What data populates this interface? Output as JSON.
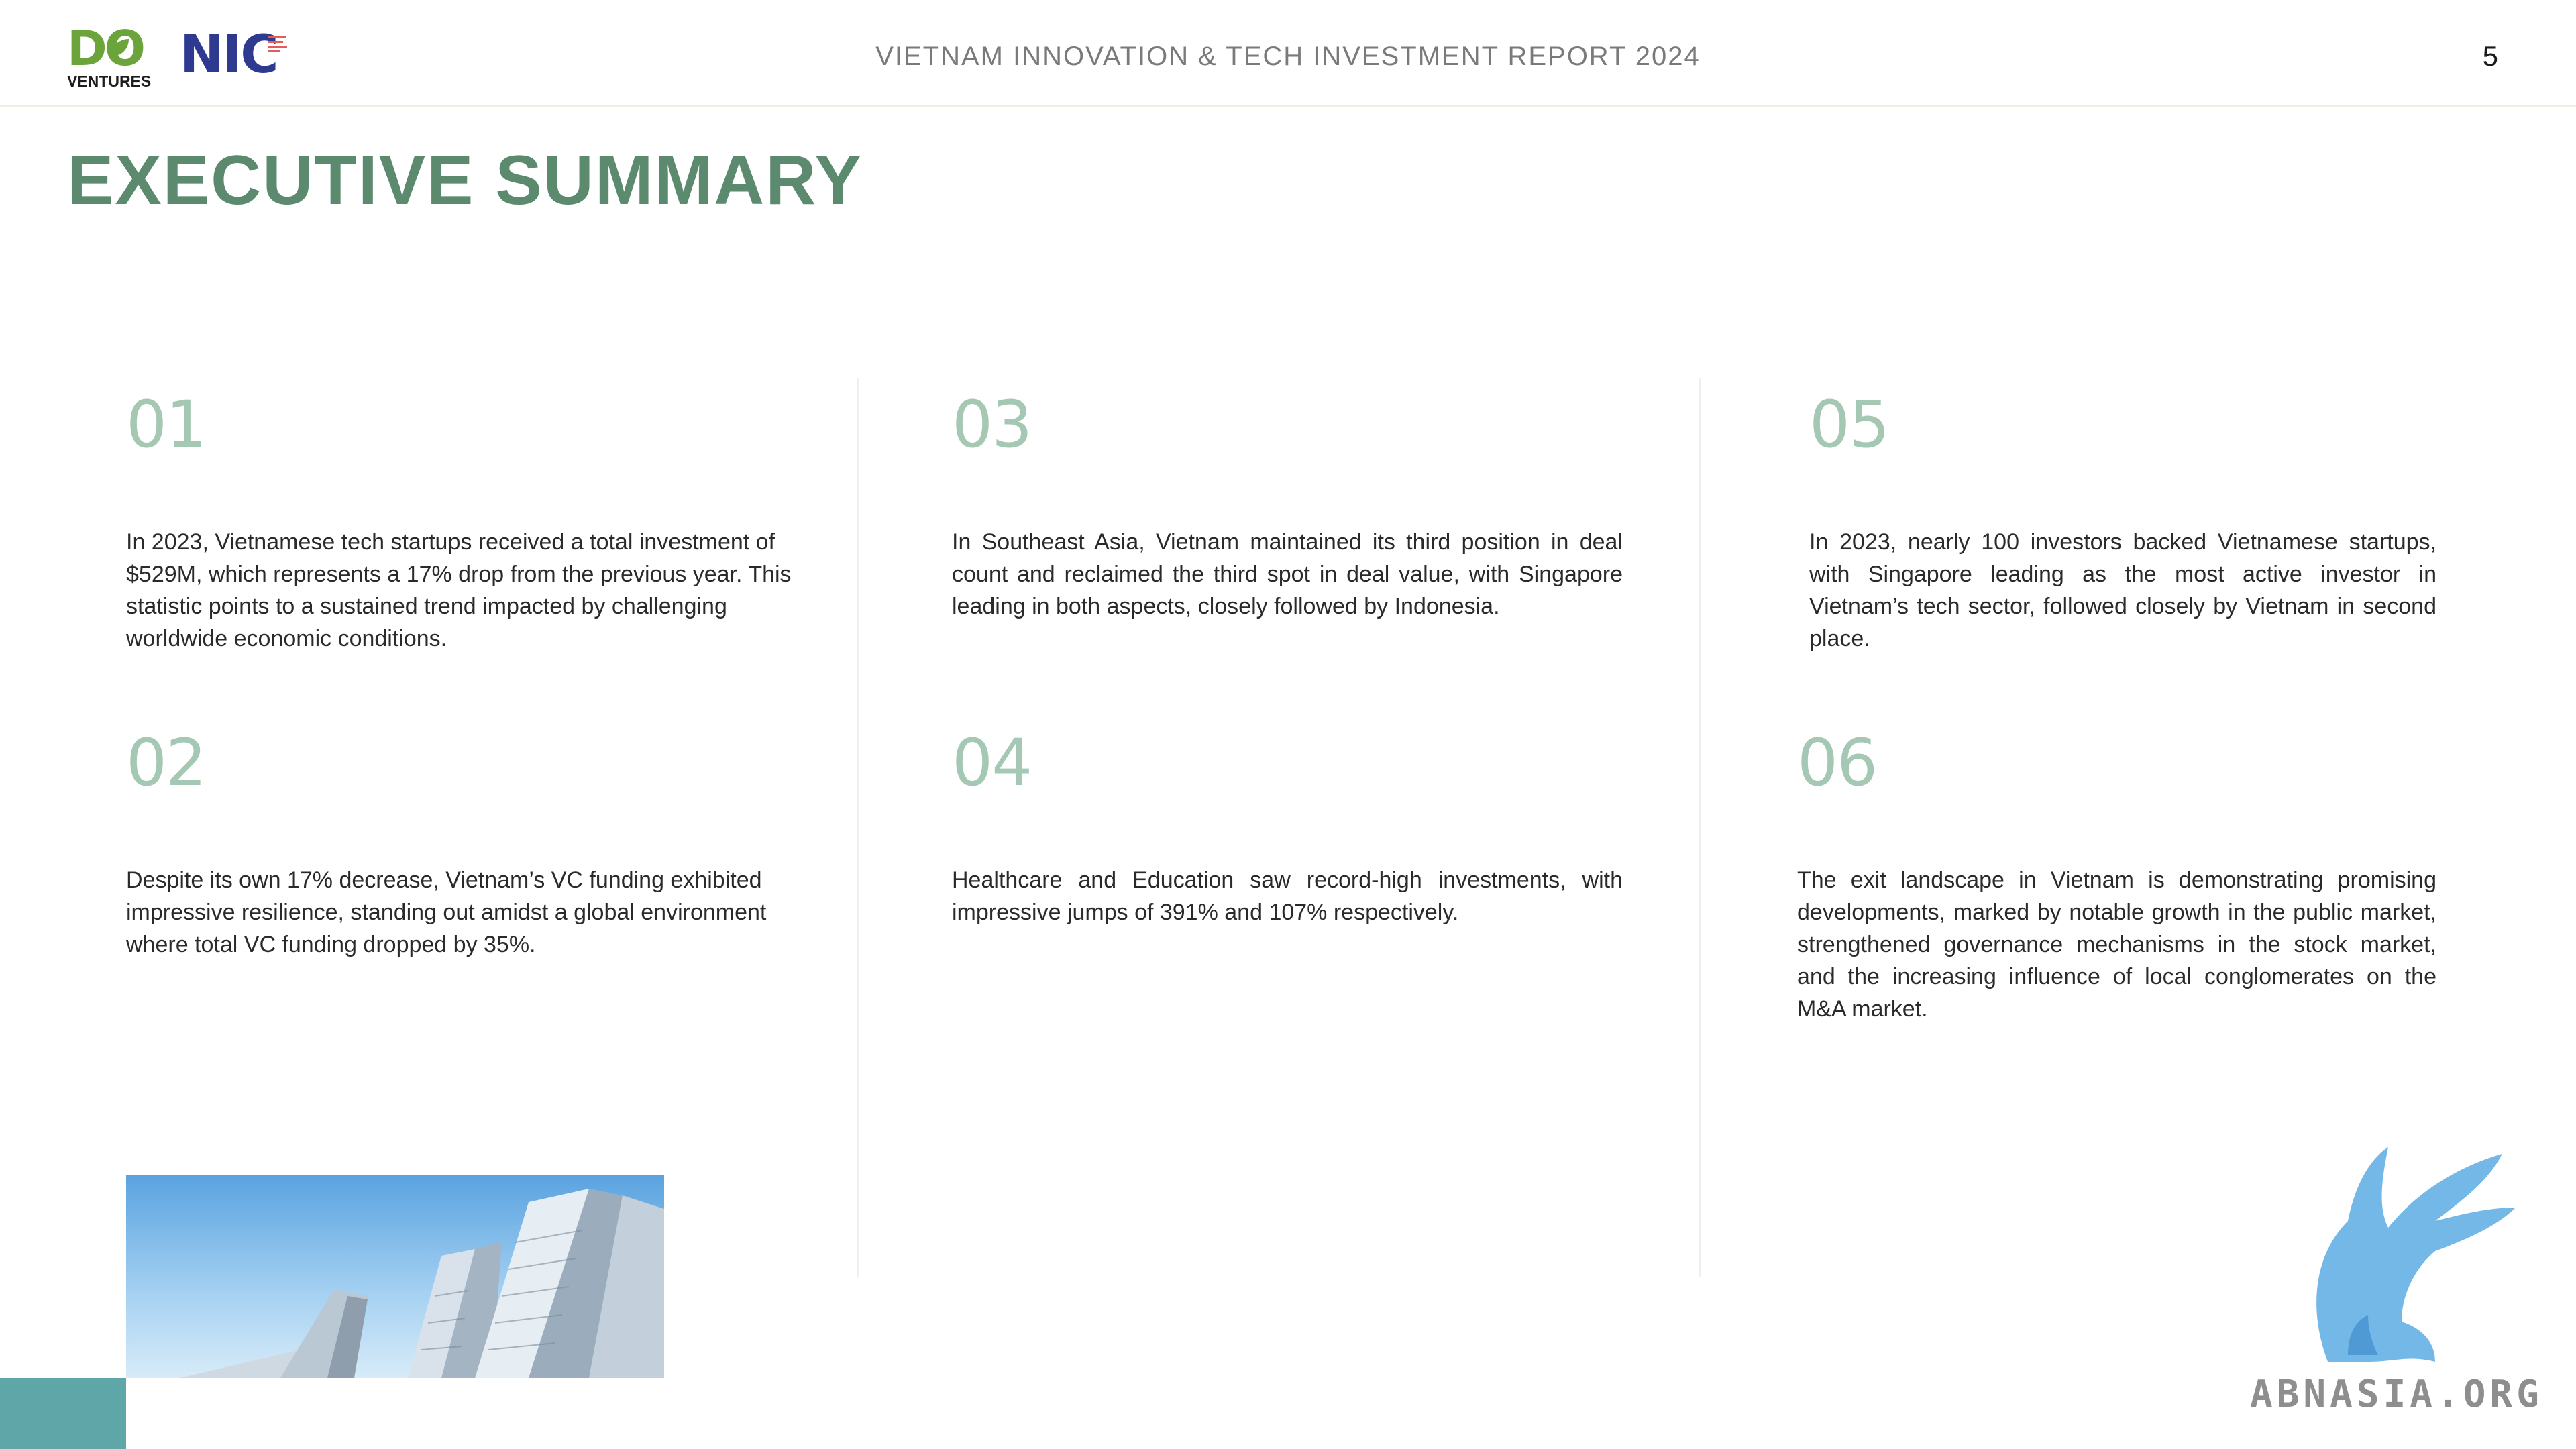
{
  "header": {
    "logo_do_text": "DO",
    "logo_do_sub": "VENTURES",
    "logo_nic_text": "NIC",
    "report_title": "VIETNAM INNOVATION & TECH INVESTMENT REPORT 2024",
    "page_number": "5"
  },
  "title": "EXECUTIVE SUMMARY",
  "items": [
    {
      "num": "01",
      "text": "In 2023, Vietnamese tech startups received a total investment of $529M, which represents a 17% drop from the previous year. This statistic points to a sustained trend impacted by challenging worldwide economic conditions."
    },
    {
      "num": "02",
      "text": "Despite its own 17% decrease, Vietnam’s VC funding exhibited impressive resilience, standing out amidst a global environment where total VC funding dropped by 35%."
    },
    {
      "num": "03",
      "text": "In Southeast Asia, Vietnam maintained its third position in deal count and reclaimed the third spot in deal value, with Singapore leading in both aspects, closely followed by Indonesia."
    },
    {
      "num": "04",
      "text": "Healthcare and Education saw record-high investments, with impressive jumps of 391% and 107% respectively."
    },
    {
      "num": "05",
      "text": "In 2023, nearly 100 investors backed Vietnamese startups, with Singapore leading as the most active investor in Vietnam’s tech sector, followed closely by Vietnam in second place."
    },
    {
      "num": "06",
      "text": "The exit landscape in Vietnam is demonstrating promising developments, marked by notable growth in the public market, strengthened governance mechanisms in the stock market, and the increasing influence of local conglomerates on the M&A market."
    }
  ],
  "watermark": "ABNASIA.ORG",
  "colors": {
    "title": "#5b8a6e",
    "numbers": "#a4c8b4",
    "do_green": "#6ba43a",
    "nic_blue": "#2e3a8f",
    "corner": "#5fa6a8",
    "watermark_blue": "#6db4e6"
  }
}
